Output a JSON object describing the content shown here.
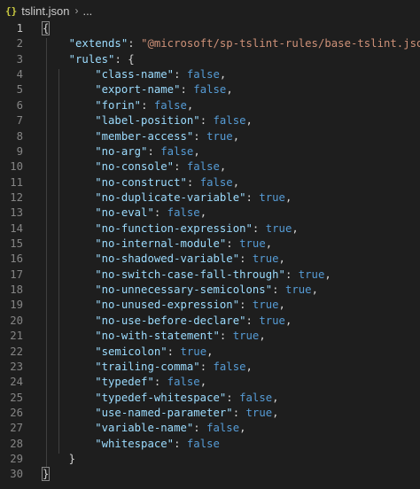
{
  "breadcrumb": {
    "file_icon": "{}",
    "file_name": "tslint.json",
    "separator_icon": "chevron-right-icon",
    "ellipsis": "..."
  },
  "editor": {
    "language": "json",
    "active_line": 1,
    "open_brace": "{",
    "close_brace": "}",
    "root_key": "extends",
    "root_value": "@microsoft/sp-tslint-rules/base-tslint.json",
    "rules_key": "rules",
    "rules": [
      {
        "name": "class-name",
        "value": "false"
      },
      {
        "name": "export-name",
        "value": "false"
      },
      {
        "name": "forin",
        "value": "false"
      },
      {
        "name": "label-position",
        "value": "false"
      },
      {
        "name": "member-access",
        "value": "true"
      },
      {
        "name": "no-arg",
        "value": "false"
      },
      {
        "name": "no-console",
        "value": "false"
      },
      {
        "name": "no-construct",
        "value": "false"
      },
      {
        "name": "no-duplicate-variable",
        "value": "true"
      },
      {
        "name": "no-eval",
        "value": "false"
      },
      {
        "name": "no-function-expression",
        "value": "true"
      },
      {
        "name": "no-internal-module",
        "value": "true"
      },
      {
        "name": "no-shadowed-variable",
        "value": "true"
      },
      {
        "name": "no-switch-case-fall-through",
        "value": "true"
      },
      {
        "name": "no-unnecessary-semicolons",
        "value": "true"
      },
      {
        "name": "no-unused-expression",
        "value": "true"
      },
      {
        "name": "no-use-before-declare",
        "value": "true"
      },
      {
        "name": "no-with-statement",
        "value": "true"
      },
      {
        "name": "semicolon",
        "value": "true"
      },
      {
        "name": "trailing-comma",
        "value": "false"
      },
      {
        "name": "typedef",
        "value": "false"
      },
      {
        "name": "typedef-whitespace",
        "value": "false"
      },
      {
        "name": "use-named-parameter",
        "value": "true"
      },
      {
        "name": "variable-name",
        "value": "false"
      },
      {
        "name": "whitespace",
        "value": "false"
      }
    ]
  },
  "colors": {
    "background": "#1e1e1e",
    "key": "#9cdcfe",
    "string": "#ce9178",
    "boolean": "#569cd6",
    "line_number": "#858585",
    "json_icon": "#cbcb41"
  }
}
